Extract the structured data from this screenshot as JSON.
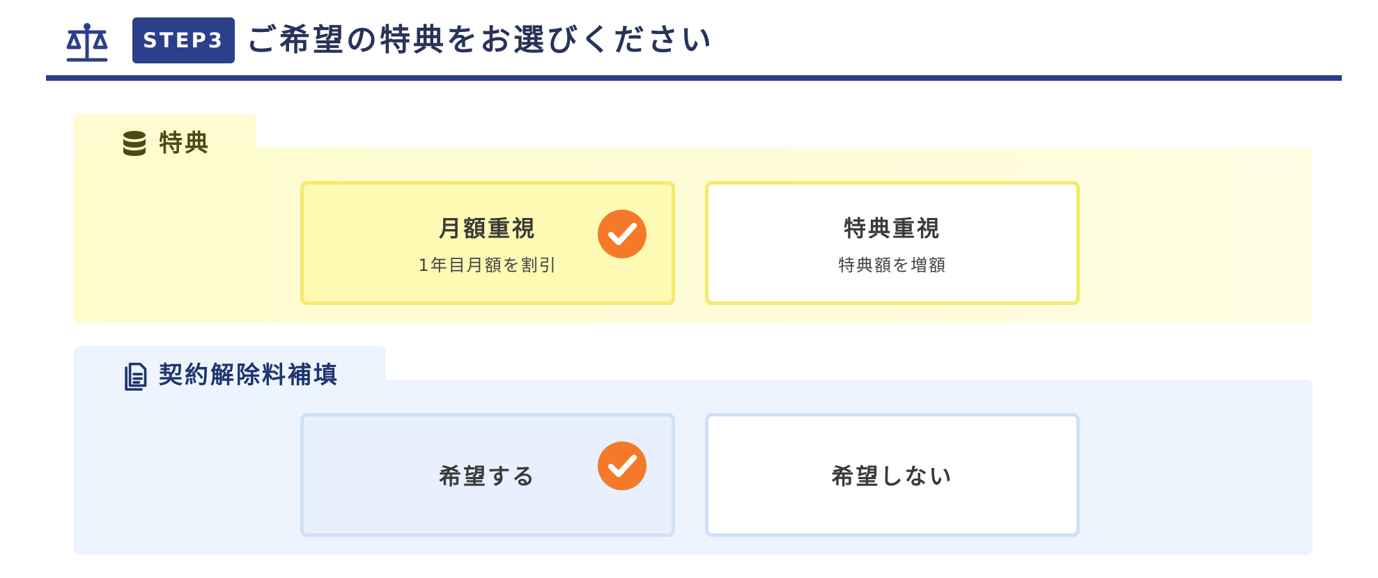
{
  "header": {
    "step_label": "STEP3",
    "title": "ご希望の特典をお選びください",
    "icon": "scale-icon",
    "accent_color": "#2b3f8b"
  },
  "sections": [
    {
      "icon": "database-icon",
      "label": "特典",
      "background": "#fefbcc",
      "border_color": "#f5ea6a",
      "options": [
        {
          "title": "月額重視",
          "subtitle": "1年目月額を割引",
          "selected": true
        },
        {
          "title": "特典重視",
          "subtitle": "特典額を増額",
          "selected": false
        }
      ]
    },
    {
      "icon": "document-icon",
      "label": "契約解除料補填",
      "background": "#eef4fd",
      "border_color": "#cfe0f8",
      "options": [
        {
          "title": "希望する",
          "selected": true
        },
        {
          "title": "希望しない",
          "selected": false
        }
      ]
    }
  ],
  "check_color": "#f47a2a"
}
